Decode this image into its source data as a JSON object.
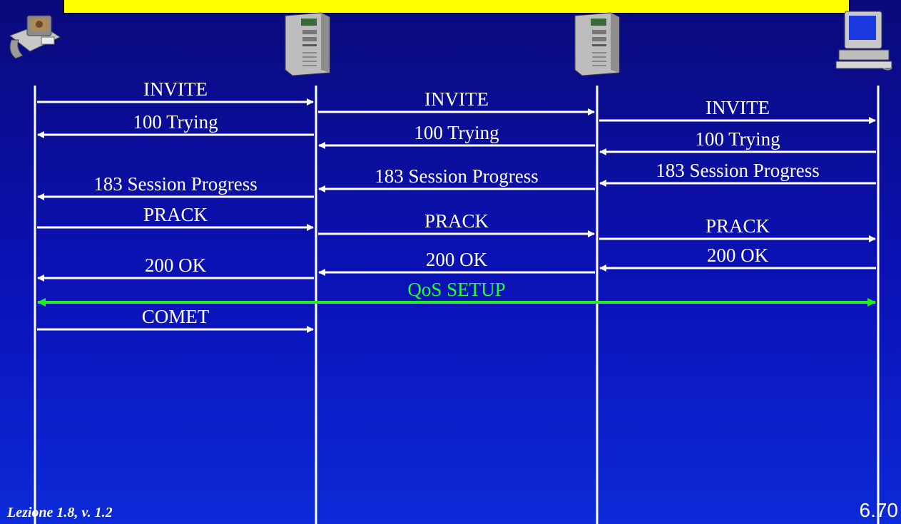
{
  "entities": [
    {
      "id": "phone",
      "icon": "phone-icon"
    },
    {
      "id": "server1",
      "icon": "server-icon"
    },
    {
      "id": "server2",
      "icon": "server-icon"
    },
    {
      "id": "pc",
      "icon": "computer-icon"
    }
  ],
  "messages": [
    {
      "label": "INVITE",
      "from": 0,
      "to": 1,
      "color": "#ffffff"
    },
    {
      "label": "100 Trying",
      "from": 1,
      "to": 0,
      "color": "#ffffff"
    },
    {
      "label": "183 Session Progress",
      "from": 1,
      "to": 0,
      "color": "#ffffff"
    },
    {
      "label": "PRACK",
      "from": 0,
      "to": 1,
      "color": "#ffffff"
    },
    {
      "label": "200 OK",
      "from": 1,
      "to": 0,
      "color": "#ffffff"
    },
    {
      "label": "INVITE",
      "from": 1,
      "to": 2,
      "color": "#ffffff"
    },
    {
      "label": "100 Trying",
      "from": 2,
      "to": 1,
      "color": "#ffffff"
    },
    {
      "label": "183 Session Progress",
      "from": 2,
      "to": 1,
      "color": "#ffffff"
    },
    {
      "label": "PRACK",
      "from": 1,
      "to": 2,
      "color": "#ffffff"
    },
    {
      "label": "200 OK",
      "from": 2,
      "to": 1,
      "color": "#ffffff"
    },
    {
      "label": "INVITE",
      "from": 2,
      "to": 3,
      "color": "#ffffff"
    },
    {
      "label": "100 Trying",
      "from": 3,
      "to": 2,
      "color": "#ffffff"
    },
    {
      "label": "183 Session Progress",
      "from": 3,
      "to": 2,
      "color": "#ffffff"
    },
    {
      "label": "PRACK",
      "from": 2,
      "to": 3,
      "color": "#ffffff"
    },
    {
      "label": "200 OK",
      "from": 3,
      "to": 2,
      "color": "#ffffff"
    },
    {
      "label": "QoS SETUP",
      "from": 0,
      "to": 3,
      "color": "#22ee22",
      "bidirectional": true
    },
    {
      "label": "COMET",
      "from": 0,
      "to": 1,
      "color": "#ffffff"
    }
  ],
  "footer": {
    "lesson": "Lezione 1.8, v. 1.2",
    "page": "6.70"
  },
  "colors": {
    "background": "#0b12b8",
    "title_bar": "#ffff00",
    "line": "#ffffff",
    "qos": "#22ee22"
  }
}
